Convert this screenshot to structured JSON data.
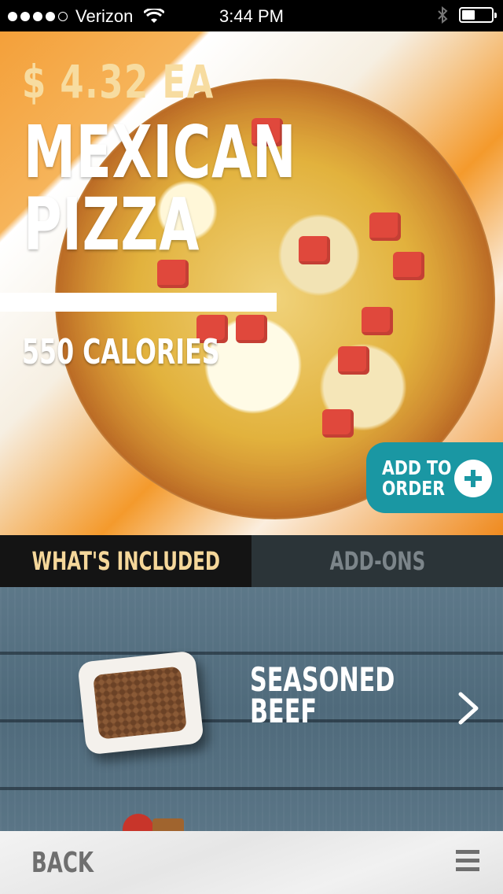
{
  "status_bar": {
    "carrier": "Verizon",
    "time": "3:44 PM",
    "signal_bars": 4,
    "signal_total": 5,
    "battery_level": 0.45,
    "icons": [
      "wifi-icon",
      "bluetooth-icon",
      "battery-icon"
    ]
  },
  "product": {
    "price": "$ 4.32 EA",
    "title_line1": "MEXICAN",
    "title_line2": "PIZZA",
    "calories": "550 CALORIES",
    "add_to_order_line1": "ADD TO",
    "add_to_order_line2": "ORDER"
  },
  "tabs": [
    {
      "label": "WHAT'S INCLUDED",
      "active": true
    },
    {
      "label": "ADD-ONS",
      "active": false
    }
  ],
  "included_items": [
    {
      "name_line1": "SEASONED",
      "name_line2": "BEEF",
      "icon": "chevron-right-icon"
    }
  ],
  "bottom_bar": {
    "back_label": "BACK",
    "menu_icon": "hamburger-menu-icon"
  },
  "colors": {
    "accent_teal": "#1a97a3",
    "price_cream": "#f7dca0",
    "active_tab_bg": "#141414",
    "inactive_tab_bg": "#2b3438"
  }
}
